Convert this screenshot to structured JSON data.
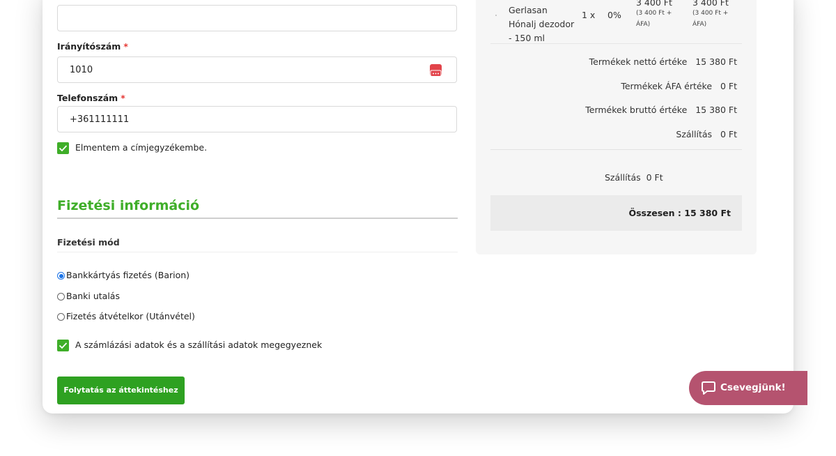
{
  "form": {
    "empty_field_value": "",
    "zip": {
      "label": "Irányítószám",
      "required_mark": "*",
      "value": "1010"
    },
    "phone": {
      "label": "Telefonszám",
      "required_mark": "*",
      "value": "+361111111"
    },
    "save_address_label": "Elmentem a címjegyzékembe."
  },
  "payment": {
    "section_title": "Fizetési információ",
    "method_label": "Fizetési mód",
    "options": [
      {
        "label": "Bankkártyás fizetés (Barion)",
        "selected": true
      },
      {
        "label": "Banki utalás",
        "selected": false
      },
      {
        "label": "Fizetés átvételkor (Utánvétel)",
        "selected": false
      }
    ],
    "same_address_label": "A számlázási adatok és a szállítási adatok megegyeznek",
    "continue_button": "Folytatás az áttekintéshez"
  },
  "order": {
    "product": {
      "name_lines": [
        "Gerlasan",
        "Hónalj dezodor",
        "- 150 ml"
      ],
      "qty": "1 x",
      "vat": "0%",
      "unit_price": "3 400 Ft",
      "unit_price_note_1": "(3 400 Ft +",
      "unit_price_note_2": "ÁFA)",
      "total_price": "3 400 Ft",
      "total_price_note_1": "(3 400 Ft +",
      "total_price_note_2": "ÁFA)"
    },
    "summary": [
      {
        "label": "Termékek nettó értéke",
        "value": "15 380 Ft"
      },
      {
        "label": "Termékek ÁFA értéke",
        "value": "0 Ft"
      },
      {
        "label": "Termékek bruttó értéke",
        "value": "15 380 Ft"
      },
      {
        "label": "Szállítás",
        "value": "0 Ft"
      }
    ],
    "shipping_label": "Szállítás",
    "shipping_value": "0 Ft",
    "total_label": "Összesen :",
    "total_value": "15 380 Ft"
  },
  "chat": {
    "label": "Csevegjünk!"
  },
  "colors": {
    "accent_green": "#3fae29",
    "button_green": "#2ea121",
    "chat_bg": "#b5536f",
    "radio_blue": "#1a73e8"
  },
  "icons": {
    "autofill": "dots-card-icon",
    "check": "check-icon",
    "chat": "chat-bubble-icon"
  }
}
